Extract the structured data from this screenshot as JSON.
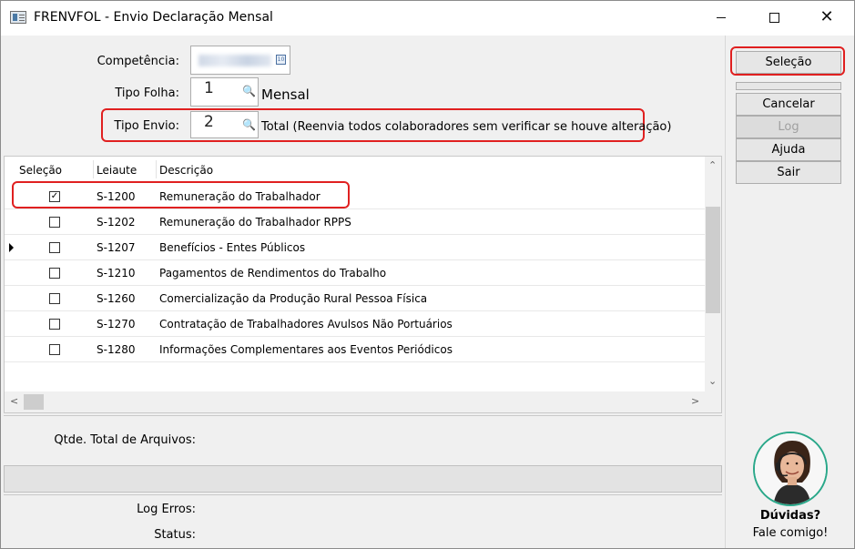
{
  "window": {
    "title": "FRENVFOL - Envio Declaração Mensal"
  },
  "form": {
    "competencia_label": "Competência:",
    "tipo_folha_label": "Tipo Folha:",
    "tipo_folha_value": "1",
    "tipo_folha_desc": "Mensal",
    "tipo_envio_label": "Tipo Envio:",
    "tipo_envio_value": "2",
    "tipo_envio_desc": "Total (Reenvia todos colaboradores sem verificar se houve alteração)"
  },
  "grid": {
    "columns": [
      "Seleção",
      "Leiaute",
      "Descrição"
    ],
    "rows": [
      {
        "selected": true,
        "leiaute": "S-1200",
        "descricao": "Remuneração do Trabalhador"
      },
      {
        "selected": false,
        "leiaute": "S-1202",
        "descricao": "Remuneração do Trabalhador RPPS"
      },
      {
        "selected": false,
        "leiaute": "S-1207",
        "descricao": "Benefícios - Entes Públicos",
        "current": true
      },
      {
        "selected": false,
        "leiaute": "S-1210",
        "descricao": "Pagamentos de Rendimentos do Trabalho"
      },
      {
        "selected": false,
        "leiaute": "S-1260",
        "descricao": "Comercialização da Produção Rural Pessoa Física"
      },
      {
        "selected": false,
        "leiaute": "S-1270",
        "descricao": "Contratação de Trabalhadores Avulsos Não Portuários"
      },
      {
        "selected": false,
        "leiaute": "S-1280",
        "descricao": "Informações Complementares aos Eventos Periódicos"
      }
    ]
  },
  "footer": {
    "qtde_label": "Qtde. Total de Arquivos:",
    "log_erros_label": "Log Erros:",
    "status_label": "Status:"
  },
  "buttons": {
    "selecao": "Seleção",
    "cancelar": "Cancelar",
    "log": "Log",
    "ajuda": "Ajuda",
    "sair": "Sair"
  },
  "help": {
    "question": "Dúvidas?",
    "subtitle": "Fale comigo!"
  },
  "colors": {
    "highlight": "#e02020",
    "avatar_ring": "#2aa88a"
  }
}
